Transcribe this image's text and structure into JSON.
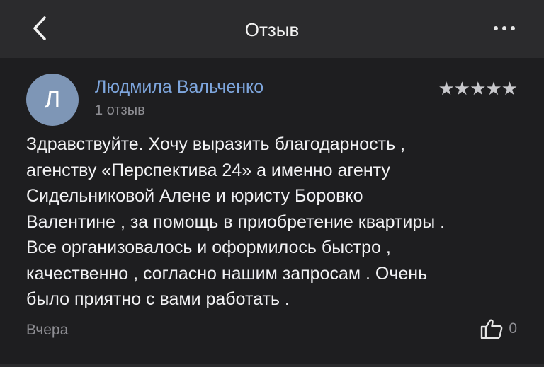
{
  "header": {
    "title": "Отзыв",
    "back_icon": "chevron-left-icon",
    "more_icon": "more-horizontal-icon"
  },
  "review": {
    "avatar_letter": "Л",
    "avatar_color": "#7e96b6",
    "author": "Людмила Вальченко",
    "reviews_count": "1 отзыв",
    "rating": 5,
    "stars": "★★★★★",
    "text_lines": [
      "Здравствуйте. Хочу выразить благодарность ,",
      "агенству «Перспектива 24» а именно агенту",
      "Сидельниковой Алене и юристу Боровко",
      "Валентине , за помощь в приобретение квартиры .",
      "Все организовалось и оформилось быстро ,",
      "качественно , согласно нашим запросам . Очень",
      "было приятно с вами работать ."
    ],
    "date": "Вчера",
    "likes": "0",
    "like_icon": "thumbs-up-icon"
  },
  "colors": {
    "background": "#1c1c1e",
    "header_bg": "#2b2b2d",
    "author": "#7ea6dd",
    "muted": "#8e8e93"
  }
}
